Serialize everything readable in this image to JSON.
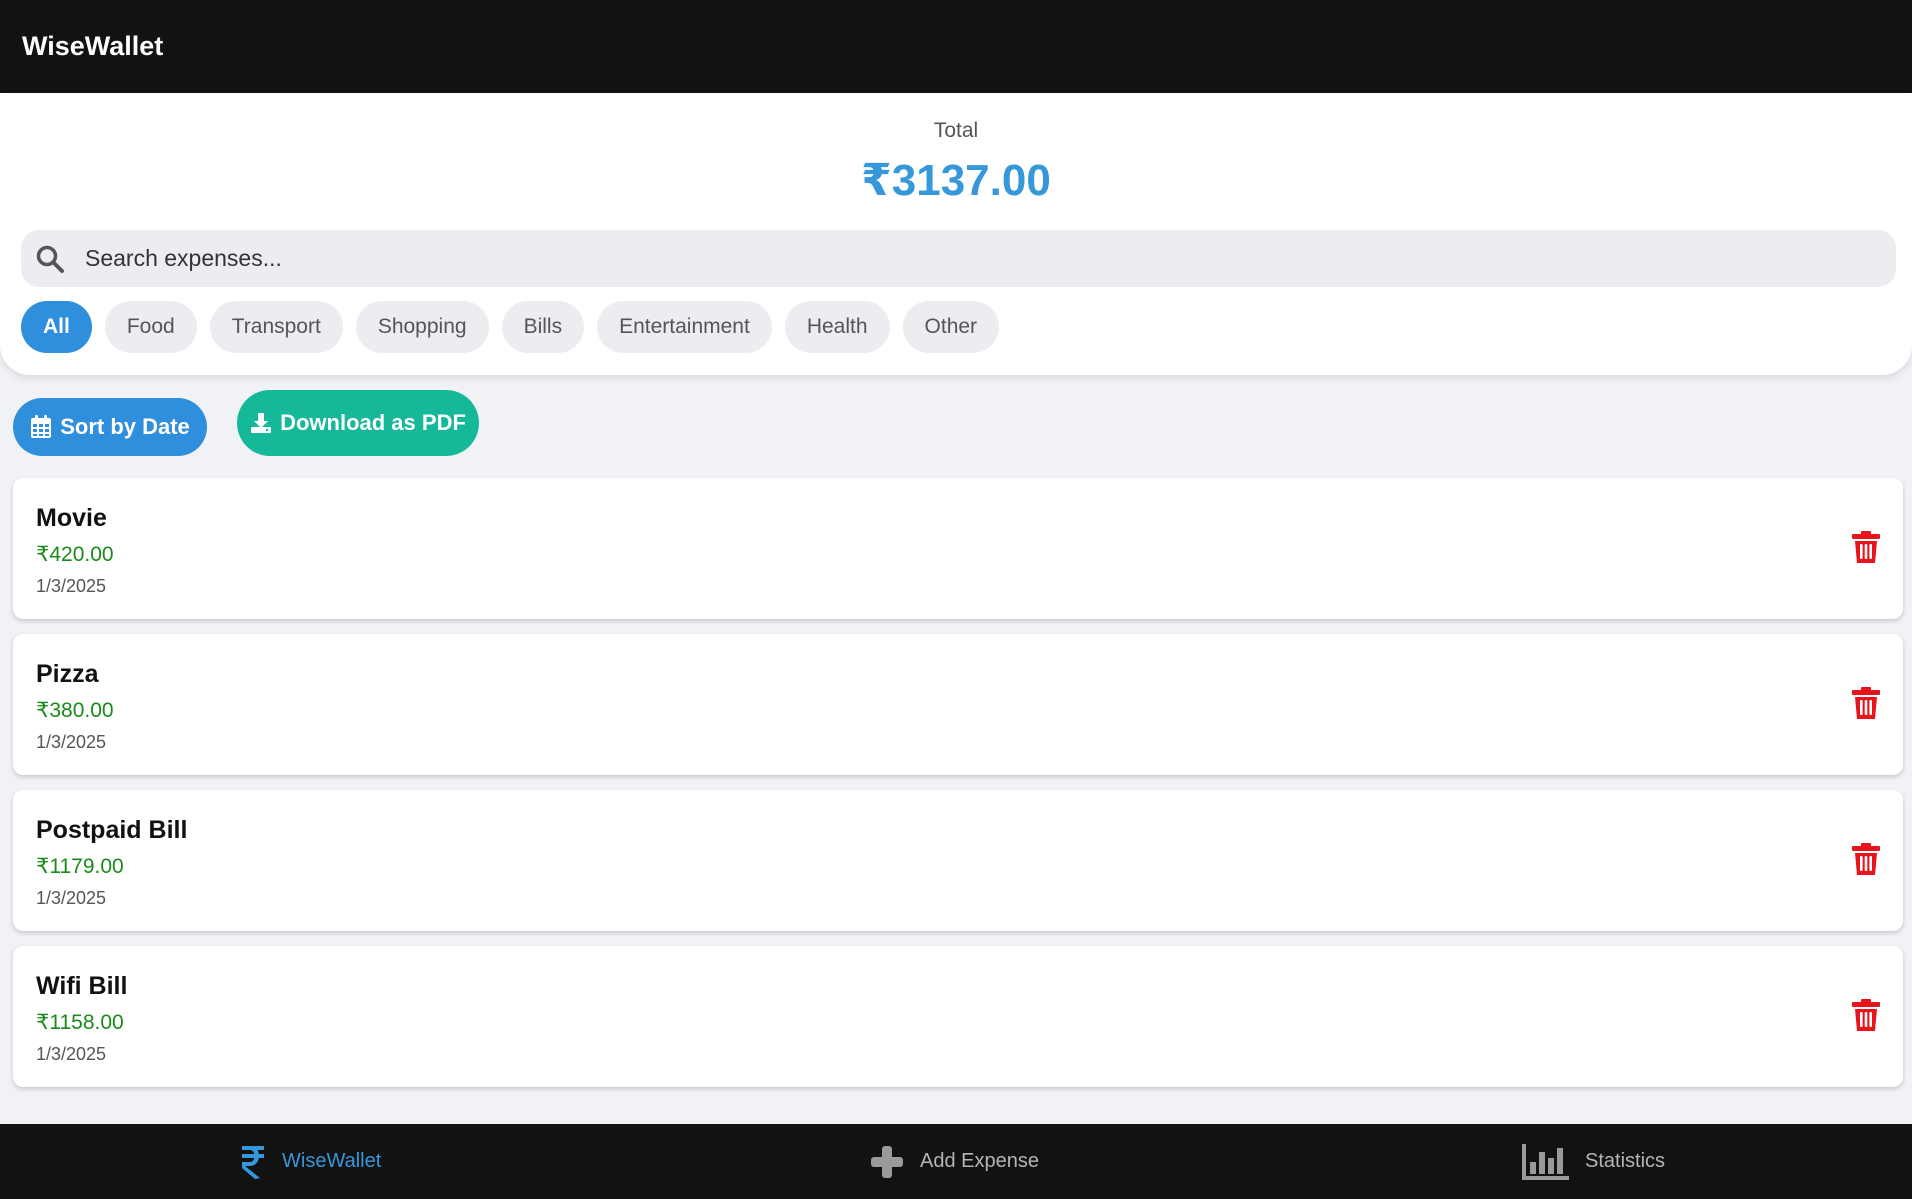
{
  "app": {
    "title": "WiseWallet"
  },
  "summary": {
    "total_label": "Total",
    "total_value": "₹3137.00"
  },
  "search": {
    "placeholder": "Search expenses..."
  },
  "filters": [
    "All",
    "Food",
    "Transport",
    "Shopping",
    "Bills",
    "Entertainment",
    "Health",
    "Other"
  ],
  "active_filter": "All",
  "actions": {
    "sort_label": "Sort by Date",
    "download_label": "Download as PDF"
  },
  "expenses": [
    {
      "name": "Movie",
      "amount": "₹420.00",
      "date": "1/3/2025"
    },
    {
      "name": "Pizza",
      "amount": "₹380.00",
      "date": "1/3/2025"
    },
    {
      "name": "Postpaid Bill",
      "amount": "₹1179.00",
      "date": "1/3/2025"
    },
    {
      "name": "Wifi Bill",
      "amount": "₹1158.00",
      "date": "1/3/2025"
    }
  ],
  "nav": {
    "home_label": "WiseWallet",
    "add_label": "Add Expense",
    "stats_label": "Statistics"
  },
  "icons": {
    "search": "search-icon",
    "sort": "calendar-icon",
    "download": "download-icon",
    "delete": "trash-icon",
    "home": "rupee-icon",
    "add": "plus-icon",
    "stats": "bar-chart-icon"
  },
  "colors": {
    "accent": "#3498db",
    "download": "#16b89a",
    "amount": "#1a8a1a",
    "delete": "#e8141c",
    "bar": "#121212"
  }
}
